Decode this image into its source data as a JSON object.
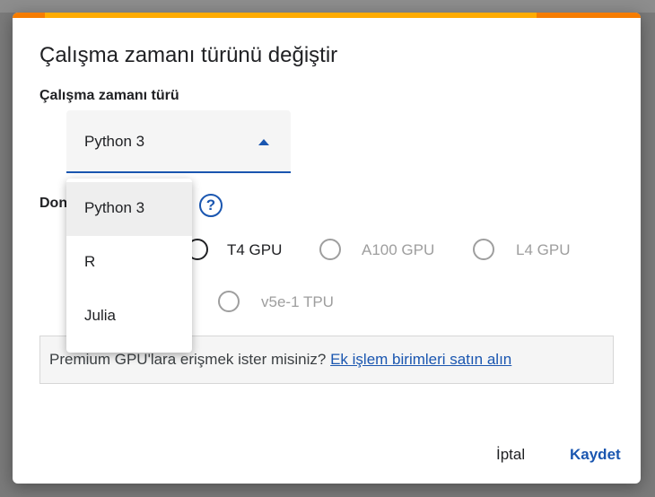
{
  "dialog": {
    "title": "Çalışma zamanı türünü değiştir",
    "colors": {
      "accent": "#1a56b0",
      "bar_orange": "#f57c00",
      "bar_yellow": "#ffab00"
    }
  },
  "runtime": {
    "label": "Çalışma zamanı türü",
    "selected_value": "Python 3",
    "options": [
      "Python 3",
      "R",
      "Julia"
    ],
    "dropdown_open": true
  },
  "accelerator": {
    "label_visible": "Don",
    "help_icon": "help-circle-icon",
    "options": [
      {
        "label": "T4 GPU",
        "enabled": true,
        "selected": false
      },
      {
        "label": "A100 GPU",
        "enabled": false,
        "selected": false
      },
      {
        "label": "L4 GPU",
        "enabled": false,
        "selected": false
      },
      {
        "label": "v5e-1 TPU",
        "enabled": false,
        "selected": false
      }
    ]
  },
  "premium": {
    "text": "Premium GPU'lara erişmek ister misiniz?",
    "link": "Ek işlem birimleri satın alın"
  },
  "actions": {
    "cancel": "İptal",
    "save": "Kaydet"
  }
}
